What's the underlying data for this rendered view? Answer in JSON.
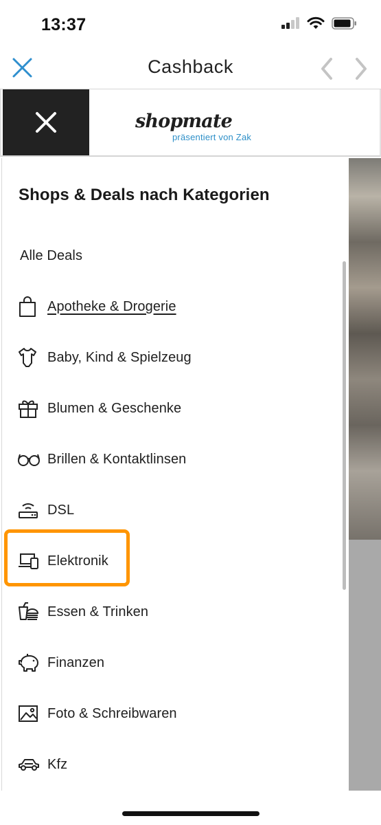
{
  "status_bar": {
    "time": "13:37"
  },
  "nav": {
    "title": "Cashback"
  },
  "header": {
    "logo_text": "shopmate",
    "logo_tagline": "präsentiert von Zak"
  },
  "drawer": {
    "heading": "Shops & Deals nach Kategorien",
    "items": [
      {
        "label": "Alle Deals",
        "icon": "none"
      },
      {
        "label": "Apotheke & Drogerie",
        "icon": "shopping-bag-icon"
      },
      {
        "label": "Baby, Kind & Spielzeug",
        "icon": "baby-bodysuit-icon"
      },
      {
        "label": "Blumen & Geschenke",
        "icon": "gift-icon"
      },
      {
        "label": "Brillen & Kontaktlinsen",
        "icon": "glasses-icon"
      },
      {
        "label": "DSL",
        "icon": "router-icon"
      },
      {
        "label": "Elektronik",
        "icon": "devices-icon"
      },
      {
        "label": "Essen & Trinken",
        "icon": "food-icon"
      },
      {
        "label": "Finanzen",
        "icon": "piggy-bank-icon"
      },
      {
        "label": "Foto & Schreibwaren",
        "icon": "image-icon"
      },
      {
        "label": "Kfz",
        "icon": "car-icon"
      }
    ]
  },
  "colors": {
    "highlight": "#ff9500",
    "nav_accent": "#2f8fce",
    "close_tile": "#222222"
  }
}
